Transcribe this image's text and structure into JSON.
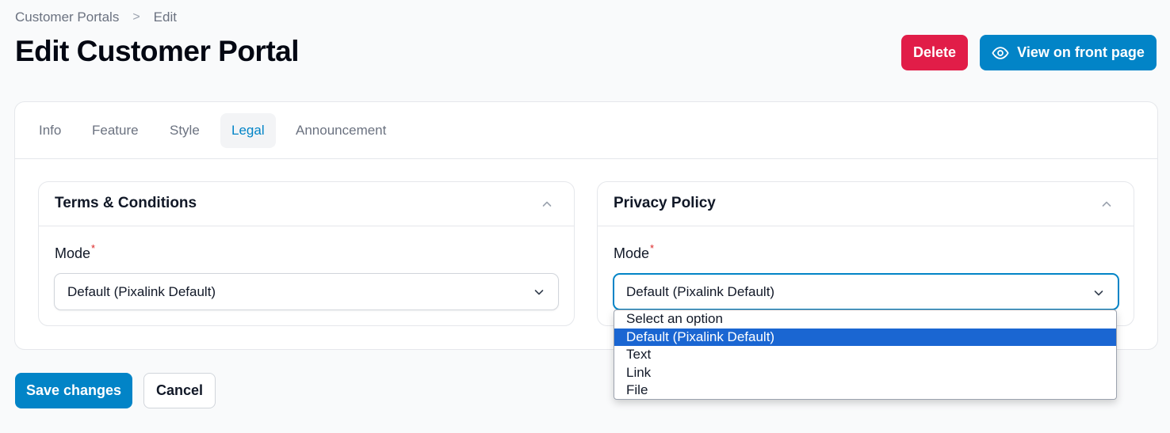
{
  "breadcrumb": {
    "items": [
      "Customer Portals",
      "Edit"
    ],
    "separator": ">"
  },
  "page": {
    "title": "Edit Customer Portal"
  },
  "header_actions": {
    "delete_label": "Delete",
    "view_label": "View on front page"
  },
  "tabs": [
    {
      "label": "Info",
      "active": false
    },
    {
      "label": "Feature",
      "active": false
    },
    {
      "label": "Style",
      "active": false
    },
    {
      "label": "Legal",
      "active": true
    },
    {
      "label": "Announcement",
      "active": false
    }
  ],
  "sections": {
    "terms": {
      "title": "Terms & Conditions",
      "mode_label": "Mode",
      "required_mark": "*",
      "mode_value": "Default (Pixalink Default)"
    },
    "privacy": {
      "title": "Privacy Policy",
      "mode_label": "Mode",
      "required_mark": "*",
      "mode_value": "Default (Pixalink Default)"
    }
  },
  "dropdown": {
    "options": [
      "Select an option",
      "Default (Pixalink Default)",
      "Text",
      "Link",
      "File"
    ],
    "selected": "Default (Pixalink Default)"
  },
  "footer": {
    "save_label": "Save changes",
    "cancel_label": "Cancel"
  },
  "colors": {
    "primary": "#0284c7",
    "danger": "#e11d48",
    "option_highlight": "#1a66d2"
  }
}
